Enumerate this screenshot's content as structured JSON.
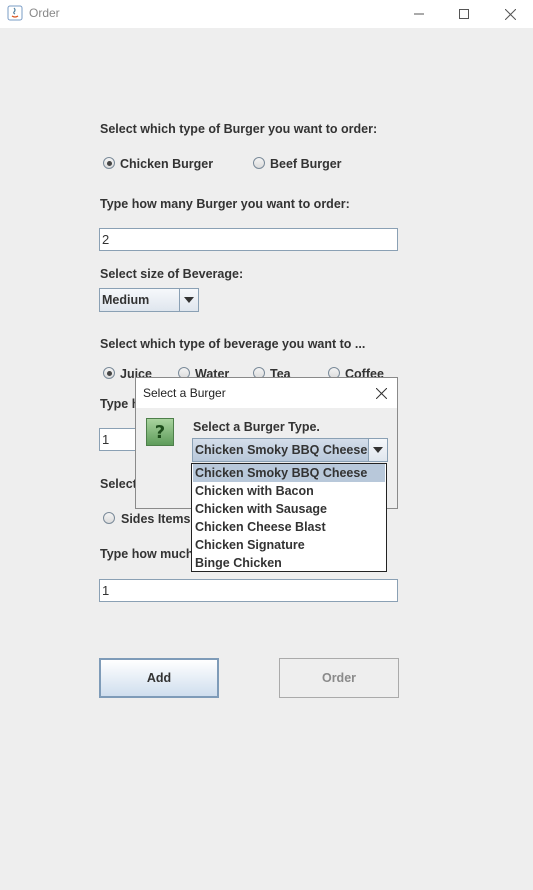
{
  "window": {
    "title": "Order"
  },
  "burger_type": {
    "label": "Select which type of Burger you want to order:",
    "options": [
      "Chicken Burger",
      "Beef Burger"
    ],
    "selected": "Chicken Burger"
  },
  "burger_qty": {
    "label": "Type how many Burger you want to order:",
    "value": "2"
  },
  "beverage_size": {
    "label": "Select size of Beverage:",
    "value": "Medium"
  },
  "beverage_type": {
    "label": "Select which type of beverage you want to ...",
    "options": [
      "Juice",
      "Water",
      "Tea",
      "Coffee"
    ],
    "selected": "Juice"
  },
  "beverage_qty": {
    "label_visible": "Type h",
    "value": "1"
  },
  "extras": {
    "label_visible": "Select",
    "option_visible": "Sides Items"
  },
  "extras_qty": {
    "label_visible": "Type how much",
    "value": "1"
  },
  "buttons": {
    "add": "Add",
    "order": "Order"
  },
  "dialog": {
    "title": "Select a Burger",
    "prompt": "Select a Burger Type.",
    "icon_glyph": "?",
    "selected": "Chicken Smoky BBQ Cheese",
    "options": [
      "Chicken Smoky BBQ Cheese",
      "Chicken with Bacon",
      "Chicken with Sausage",
      "Chicken Cheese Blast",
      "Chicken Signature",
      "Binge Chicken"
    ]
  },
  "colors": {
    "dialog_icon_green": "#7fb77a",
    "selection_blue": "#b8c8da",
    "add_button_border": "#7e9bb8"
  }
}
